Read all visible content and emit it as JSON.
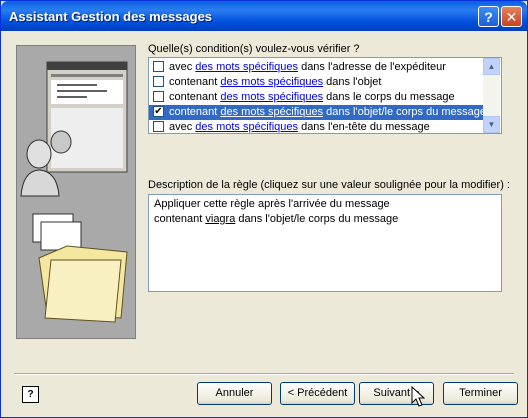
{
  "window": {
    "title": "Assistant Gestion des messages"
  },
  "titlebar": {
    "help_glyph": "?",
    "close_glyph": "✕"
  },
  "conditions": {
    "label": "Quelle(s) condition(s) voulez-vous vérifier ?",
    "items": [
      {
        "pre": "avec ",
        "link": "des mots spécifiques",
        "post": " dans l'adresse de l'expéditeur",
        "checked": false,
        "selected": false
      },
      {
        "pre": "contenant ",
        "link": "des mots spécifiques",
        "post": " dans l'objet",
        "checked": false,
        "selected": false
      },
      {
        "pre": "contenant ",
        "link": "des mots spécifiques",
        "post": " dans le corps du message",
        "checked": false,
        "selected": false
      },
      {
        "pre": "contenant ",
        "link": "des mots spécifiques",
        "post": " dans l'objet/le corps du message",
        "checked": true,
        "selected": true
      },
      {
        "pre": "avec ",
        "link": "des mots spécifiques",
        "post": " dans l'en-tête du message",
        "checked": false,
        "selected": false
      }
    ]
  },
  "description": {
    "label": "Description de la règle (cliquez sur une valeur soulignée pour la modifier) :",
    "line1": "Appliquer cette règle après l'arrivée du message",
    "line2_pre": "contenant ",
    "line2_link": "viagra",
    "line2_post": " dans l'objet/le corps du message"
  },
  "buttons": {
    "help": "?",
    "cancel": "Annuler",
    "back": "< Précédent",
    "next": "Suivant >",
    "finish": "Terminer"
  },
  "colors": {
    "selection": "#316ac5",
    "titlebar": "#0a5fe0",
    "face": "#ece9d8"
  }
}
